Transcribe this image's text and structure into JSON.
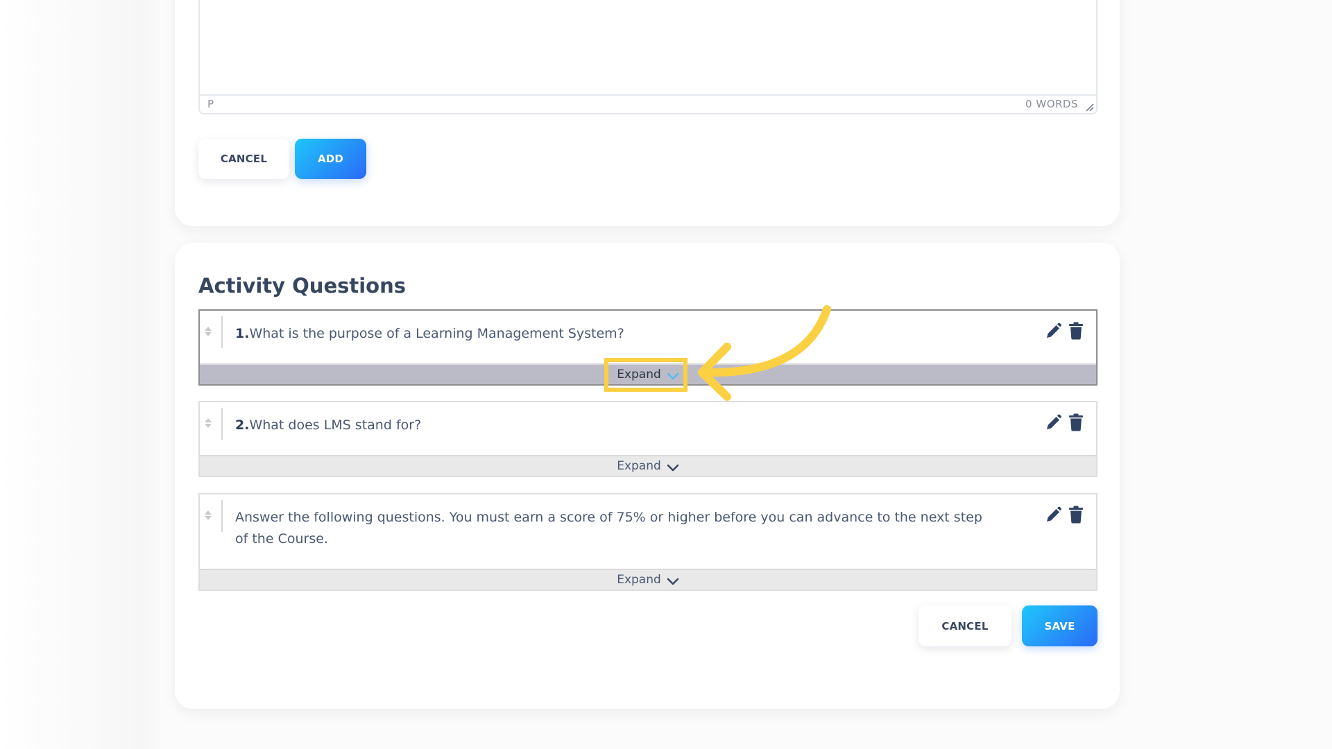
{
  "editor": {
    "status_path": "P",
    "word_count": "0 WORDS"
  },
  "form_actions": {
    "cancel_label": "CANCEL",
    "add_label": "ADD"
  },
  "activity_questions": {
    "title": "Activity Questions",
    "items": [
      {
        "number": "1.",
        "text": "What is the purpose of a Learning Management System?",
        "expand_label": "Expand",
        "highlighted": true
      },
      {
        "number": "2.",
        "text": "What does LMS stand for?",
        "expand_label": "Expand",
        "highlighted": false
      },
      {
        "number": "",
        "text": "Answer the following questions. You must earn a score of 75% or higher before you can advance to the next step of the Course.",
        "expand_label": "Expand",
        "highlighted": false
      }
    ],
    "icons": {
      "edit": "pencil-icon",
      "delete": "trash-icon",
      "drag": "drag-handle-icon",
      "expand": "chevron-down-icon"
    }
  },
  "footer_actions": {
    "cancel_label": "CANCEL",
    "save_label": "SAVE"
  },
  "colors": {
    "accent_gradient_start": "#1fc6fb",
    "accent_gradient_end": "#2a6bf6",
    "annotation": "#fbd043",
    "icon": "#2f4266",
    "title": "#36465f"
  }
}
